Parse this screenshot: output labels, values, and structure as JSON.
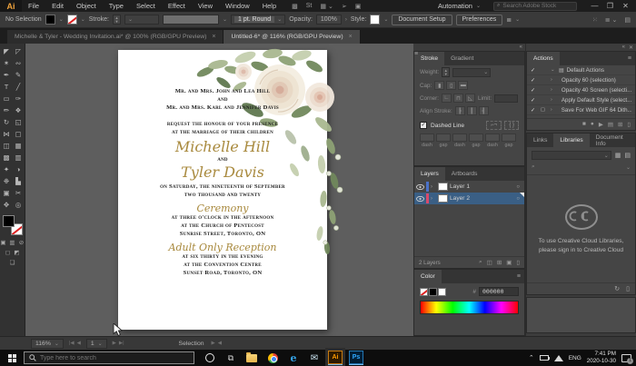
{
  "colors": {
    "accent_gold": "#a8893d",
    "selection_blue": "#3a5f85",
    "ai_orange": "#ff9a00",
    "ps_blue": "#31a8ff"
  },
  "menu_bar": {
    "logo": "Ai",
    "menus": [
      "File",
      "Edit",
      "Object",
      "Type",
      "Select",
      "Effect",
      "View",
      "Window",
      "Help"
    ],
    "icons": [
      {
        "g": "▩"
      },
      {
        "g": "St"
      },
      {
        "g": "▦ ⌄"
      },
      {
        "g": "➢"
      },
      {
        "g": "▣"
      }
    ],
    "automation": "Automation",
    "search_placeholder": "Search Adobe Stock",
    "window_controls": {
      "minimize": "—",
      "restore": "❐",
      "close": "✕"
    }
  },
  "options_bar": {
    "no_selection": "No Selection",
    "stroke_label": "Stroke:",
    "brush": "1 pt. Round",
    "opacity_label": "Opacity:",
    "opacity_value": "100%",
    "style_label": "Style:",
    "document_setup": "Document Setup",
    "preferences": "Preferences",
    "align_icon": "≣",
    "right_icons": [
      {
        "g": "⁙"
      },
      {
        "g": "≣ ⌄"
      },
      {
        "g": "▤"
      }
    ]
  },
  "document_tabs": [
    {
      "label": "Michelle & Tyler - Wedding Invitation.ai* @ 100% (RGB/GPU Preview)",
      "close": "×",
      "cls": ""
    },
    {
      "label": "Untitled-6* @ 116% (RGB/GPU Preview)",
      "close": "×",
      "cls": "active"
    }
  ],
  "tools": [
    {
      "g": "◤",
      "n": "selection-tool"
    },
    {
      "g": "◸",
      "n": "direct-selection-tool"
    },
    {
      "g": "✶",
      "n": "magic-wand-tool"
    },
    {
      "g": "∾",
      "n": "lasso-tool"
    },
    {
      "g": "✒",
      "n": "pen-tool"
    },
    {
      "g": "✎",
      "n": "curvature-tool"
    },
    {
      "g": "T",
      "n": "type-tool"
    },
    {
      "g": "╱",
      "n": "line-segment-tool"
    },
    {
      "g": "▭",
      "n": "rectangle-tool"
    },
    {
      "g": "✑",
      "n": "paintbrush-tool"
    },
    {
      "g": "✏",
      "n": "pencil-tool"
    },
    {
      "g": "❖",
      "n": "shaper-tool"
    },
    {
      "g": "↻",
      "n": "rotate-tool"
    },
    {
      "g": "◱",
      "n": "scale-tool"
    },
    {
      "g": "⋈",
      "n": "width-tool"
    },
    {
      "g": "▢",
      "n": "free-transform-tool"
    },
    {
      "g": "◫",
      "n": "shape-builder-tool"
    },
    {
      "g": "▦",
      "n": "perspective-grid-tool"
    },
    {
      "g": "▩",
      "n": "mesh-tool"
    },
    {
      "g": "▥",
      "n": "gradient-tool"
    },
    {
      "g": "✦",
      "n": "eyedropper-tool"
    },
    {
      "g": "◑",
      "n": "blend-tool"
    },
    {
      "g": "❉",
      "n": "symbol-sprayer-tool"
    },
    {
      "g": "▙",
      "n": "column-graph-tool"
    },
    {
      "g": "▣",
      "n": "artboard-tool"
    },
    {
      "g": "✂",
      "n": "slice-tool"
    },
    {
      "g": "✥",
      "n": "hand-tool"
    },
    {
      "g": "◎",
      "n": "zoom-tool"
    }
  ],
  "invitation": {
    "lines": [
      {
        "t": "Mr. and Mrs. John and Lea Hill",
        "c": "caps"
      },
      {
        "t": "and",
        "c": "caps"
      },
      {
        "t": "Mr. and Mrs. Karl and Jennifer Davis",
        "c": "caps"
      },
      {
        "t": "request the honour of your presence",
        "c": "caps gap"
      },
      {
        "t": "at the marriage of their children",
        "c": "caps"
      },
      {
        "t": "Michelle Hill",
        "c": "script lg gap-sm"
      },
      {
        "t": "and",
        "c": "caps"
      },
      {
        "t": "Tyler Davis",
        "c": "script lg"
      },
      {
        "t": "on Saturday, the nineteenth of September",
        "c": "caps gap-sm"
      },
      {
        "t": "two thousand and twenty",
        "c": "caps"
      },
      {
        "t": "Ceremony",
        "c": "script md gap-sm"
      },
      {
        "t": "at three o'clock in the afternoon",
        "c": "caps"
      },
      {
        "t": "at the Church of Pentecost",
        "c": "caps"
      },
      {
        "t": "Sunrise Street, Toronto, ON",
        "c": "caps"
      },
      {
        "t": "Adult Only Reception",
        "c": "script md gap-sm"
      },
      {
        "t": "at six thirty in the evening",
        "c": "caps"
      },
      {
        "t": "at the Convention Centre",
        "c": "caps"
      },
      {
        "t": "Sunset Road, Toronto, ON",
        "c": "caps"
      }
    ]
  },
  "panels": {
    "stroke": {
      "tabs": [
        {
          "label": "Stroke",
          "cls": "active"
        },
        {
          "label": "Gradient",
          "cls": ""
        }
      ],
      "weight_label": "Weight:",
      "cap_label": "Cap:",
      "cap_icons": [
        {
          "g": "▮"
        },
        {
          "g": "▯"
        },
        {
          "g": "▬"
        }
      ],
      "corner_label": "Corner:",
      "corner_icons": [
        {
          "g": "∟"
        },
        {
          "g": "⊓"
        },
        {
          "g": "◺"
        }
      ],
      "limit_label": "Limit:",
      "align_label": "Align Stroke:",
      "align_icons": [
        {
          "g": "┠"
        },
        {
          "g": "┃"
        },
        {
          "g": "┨"
        }
      ],
      "dashed_check": "✓",
      "dashed_label": "Dashed Line",
      "dash_fields": [
        {
          "l": "dash"
        },
        {
          "l": "gap"
        },
        {
          "l": "dash"
        },
        {
          "l": "gap"
        },
        {
          "l": "dash"
        },
        {
          "l": "gap"
        }
      ]
    },
    "actions": {
      "title": "Actions",
      "rows": [
        {
          "check": "✓",
          "box": "",
          "arrow": "⌄",
          "folder": "▤",
          "label": "Default Actions"
        },
        {
          "check": "✓",
          "box": "",
          "arrow": "›",
          "folder": "",
          "label": "Opacity 60 (selection)"
        },
        {
          "check": "✓",
          "box": "",
          "arrow": "›",
          "folder": "",
          "label": "Opacity 40 Screen (selecti..."
        },
        {
          "check": "✓",
          "box": "",
          "arrow": "›",
          "folder": "",
          "label": "Apply Default Style (select..."
        },
        {
          "check": "✓",
          "box": "▢",
          "arrow": "›",
          "folder": "",
          "label": "Save For Web GIF 64 Dith..."
        }
      ],
      "footer_icons": [
        {
          "g": "■"
        },
        {
          "g": "●"
        },
        {
          "g": "▶"
        },
        {
          "g": "▤"
        },
        {
          "g": "⊞"
        },
        {
          "g": "▯"
        }
      ]
    },
    "layers": {
      "tabs": [
        {
          "label": "Layers",
          "cls": "active"
        },
        {
          "label": "Artboards",
          "cls": ""
        }
      ],
      "rows": [
        {
          "name": "Layer 1",
          "color": "#4b72c9",
          "cls": "",
          "expand": "›",
          "target": "○"
        },
        {
          "name": "Layer 2",
          "color": "#d84a6b",
          "cls": "selected",
          "expand": "›",
          "target": "○"
        }
      ],
      "count": "2 Layers",
      "footer_icons": [
        {
          "g": "⌕"
        },
        {
          "g": "◫"
        },
        {
          "g": "⊞"
        },
        {
          "g": "▣"
        },
        {
          "g": "▯"
        }
      ]
    },
    "libraries": {
      "tabs": [
        {
          "label": "Links",
          "cls": ""
        },
        {
          "label": "Libraries",
          "cls": "active"
        },
        {
          "label": "Document Info",
          "cls": ""
        }
      ],
      "message_line1": "To use Creative Cloud Libraries,",
      "message_line2": "please sign in to Creative Cloud",
      "footer_icons": [
        {
          "g": "↻"
        },
        {
          "g": "▯"
        }
      ]
    },
    "color": {
      "title": "Color",
      "hex_prefix": "#",
      "hex": "000000"
    }
  },
  "status_bar": {
    "zoom": "116%",
    "artboard": "1",
    "tool": "Selection"
  },
  "taskbar": {
    "search_placeholder": "Type here to search",
    "ai_label": "Ai",
    "ps_label": "Ps",
    "language": "ENG",
    "time": "7:41 PM",
    "date": "2020-10-30",
    "badge": "1"
  }
}
